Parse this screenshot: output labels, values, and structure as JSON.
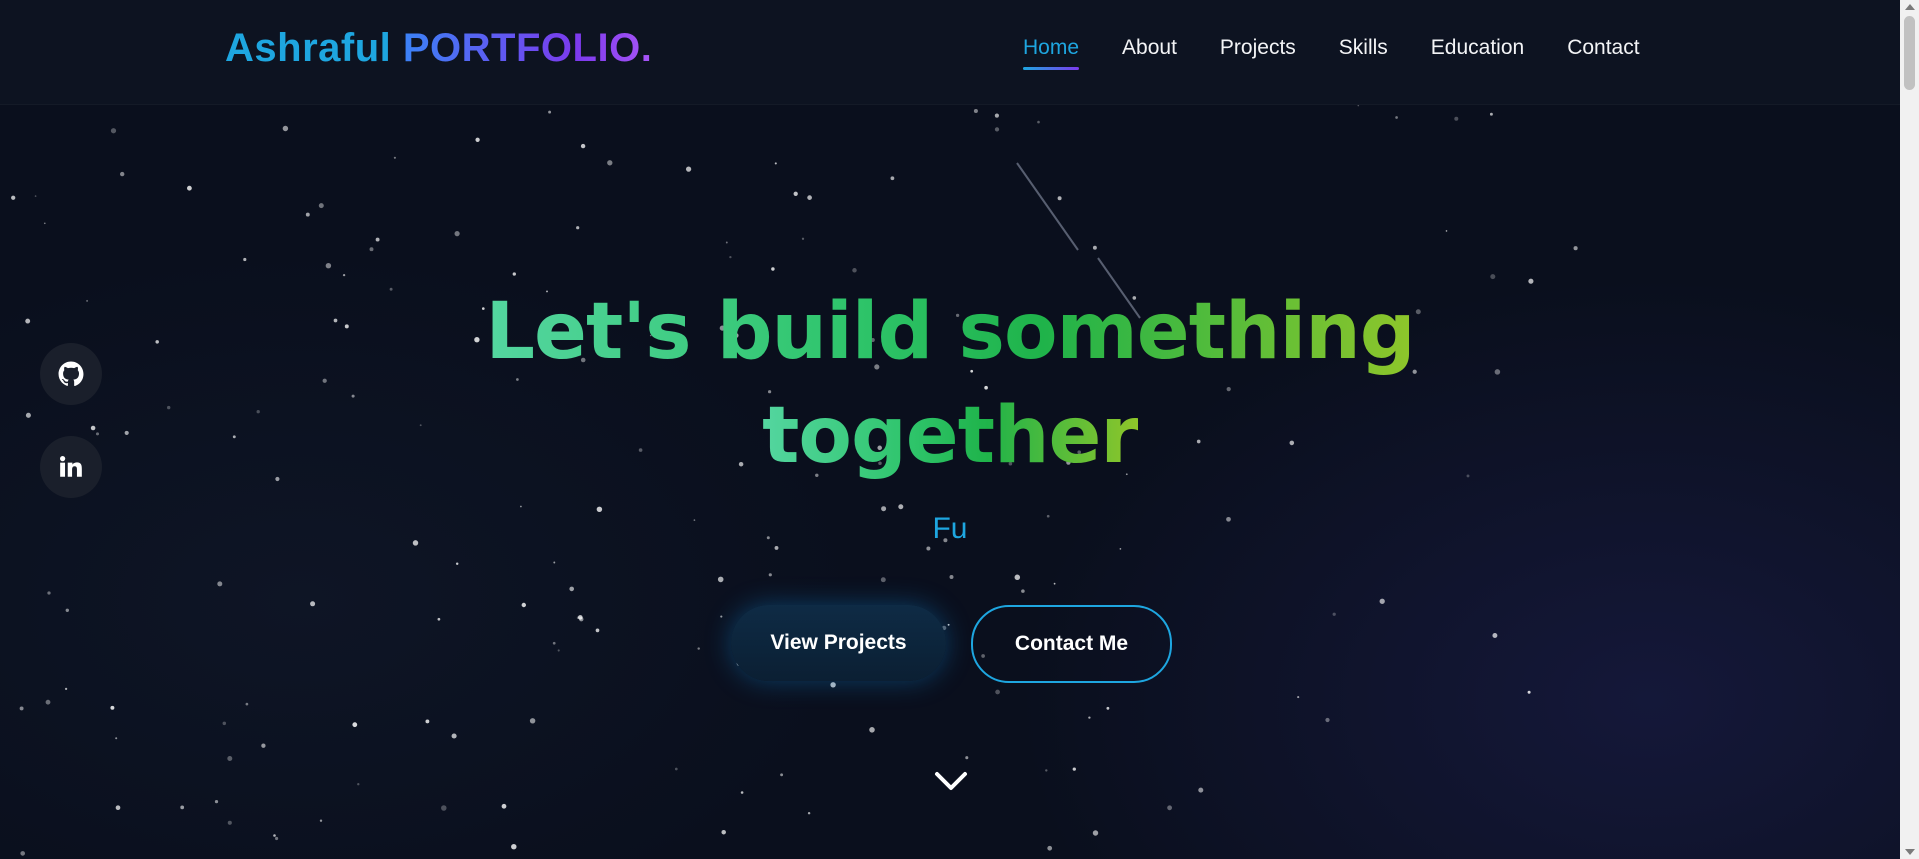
{
  "header": {
    "logo_part1": "Ashraful",
    "logo_part2": "PORTFOLIO."
  },
  "nav": {
    "items": [
      {
        "label": "Home",
        "active": true
      },
      {
        "label": "About"
      },
      {
        "label": "Projects"
      },
      {
        "label": "Skills"
      },
      {
        "label": "Education"
      },
      {
        "label": "Contact"
      }
    ]
  },
  "social": {
    "icons": [
      "github-icon",
      "linkedin-icon"
    ]
  },
  "hero": {
    "title_line1": "Let's build something",
    "title_line2": "together",
    "typed_text": "Fu",
    "primary_button": "View Projects",
    "secondary_button": "Contact Me"
  },
  "colors": {
    "background": "#0a0f1d",
    "accent": "#1ea6e0",
    "purple": "#7c3aed",
    "green": "#2ec46a",
    "lime": "#8fc62a"
  }
}
